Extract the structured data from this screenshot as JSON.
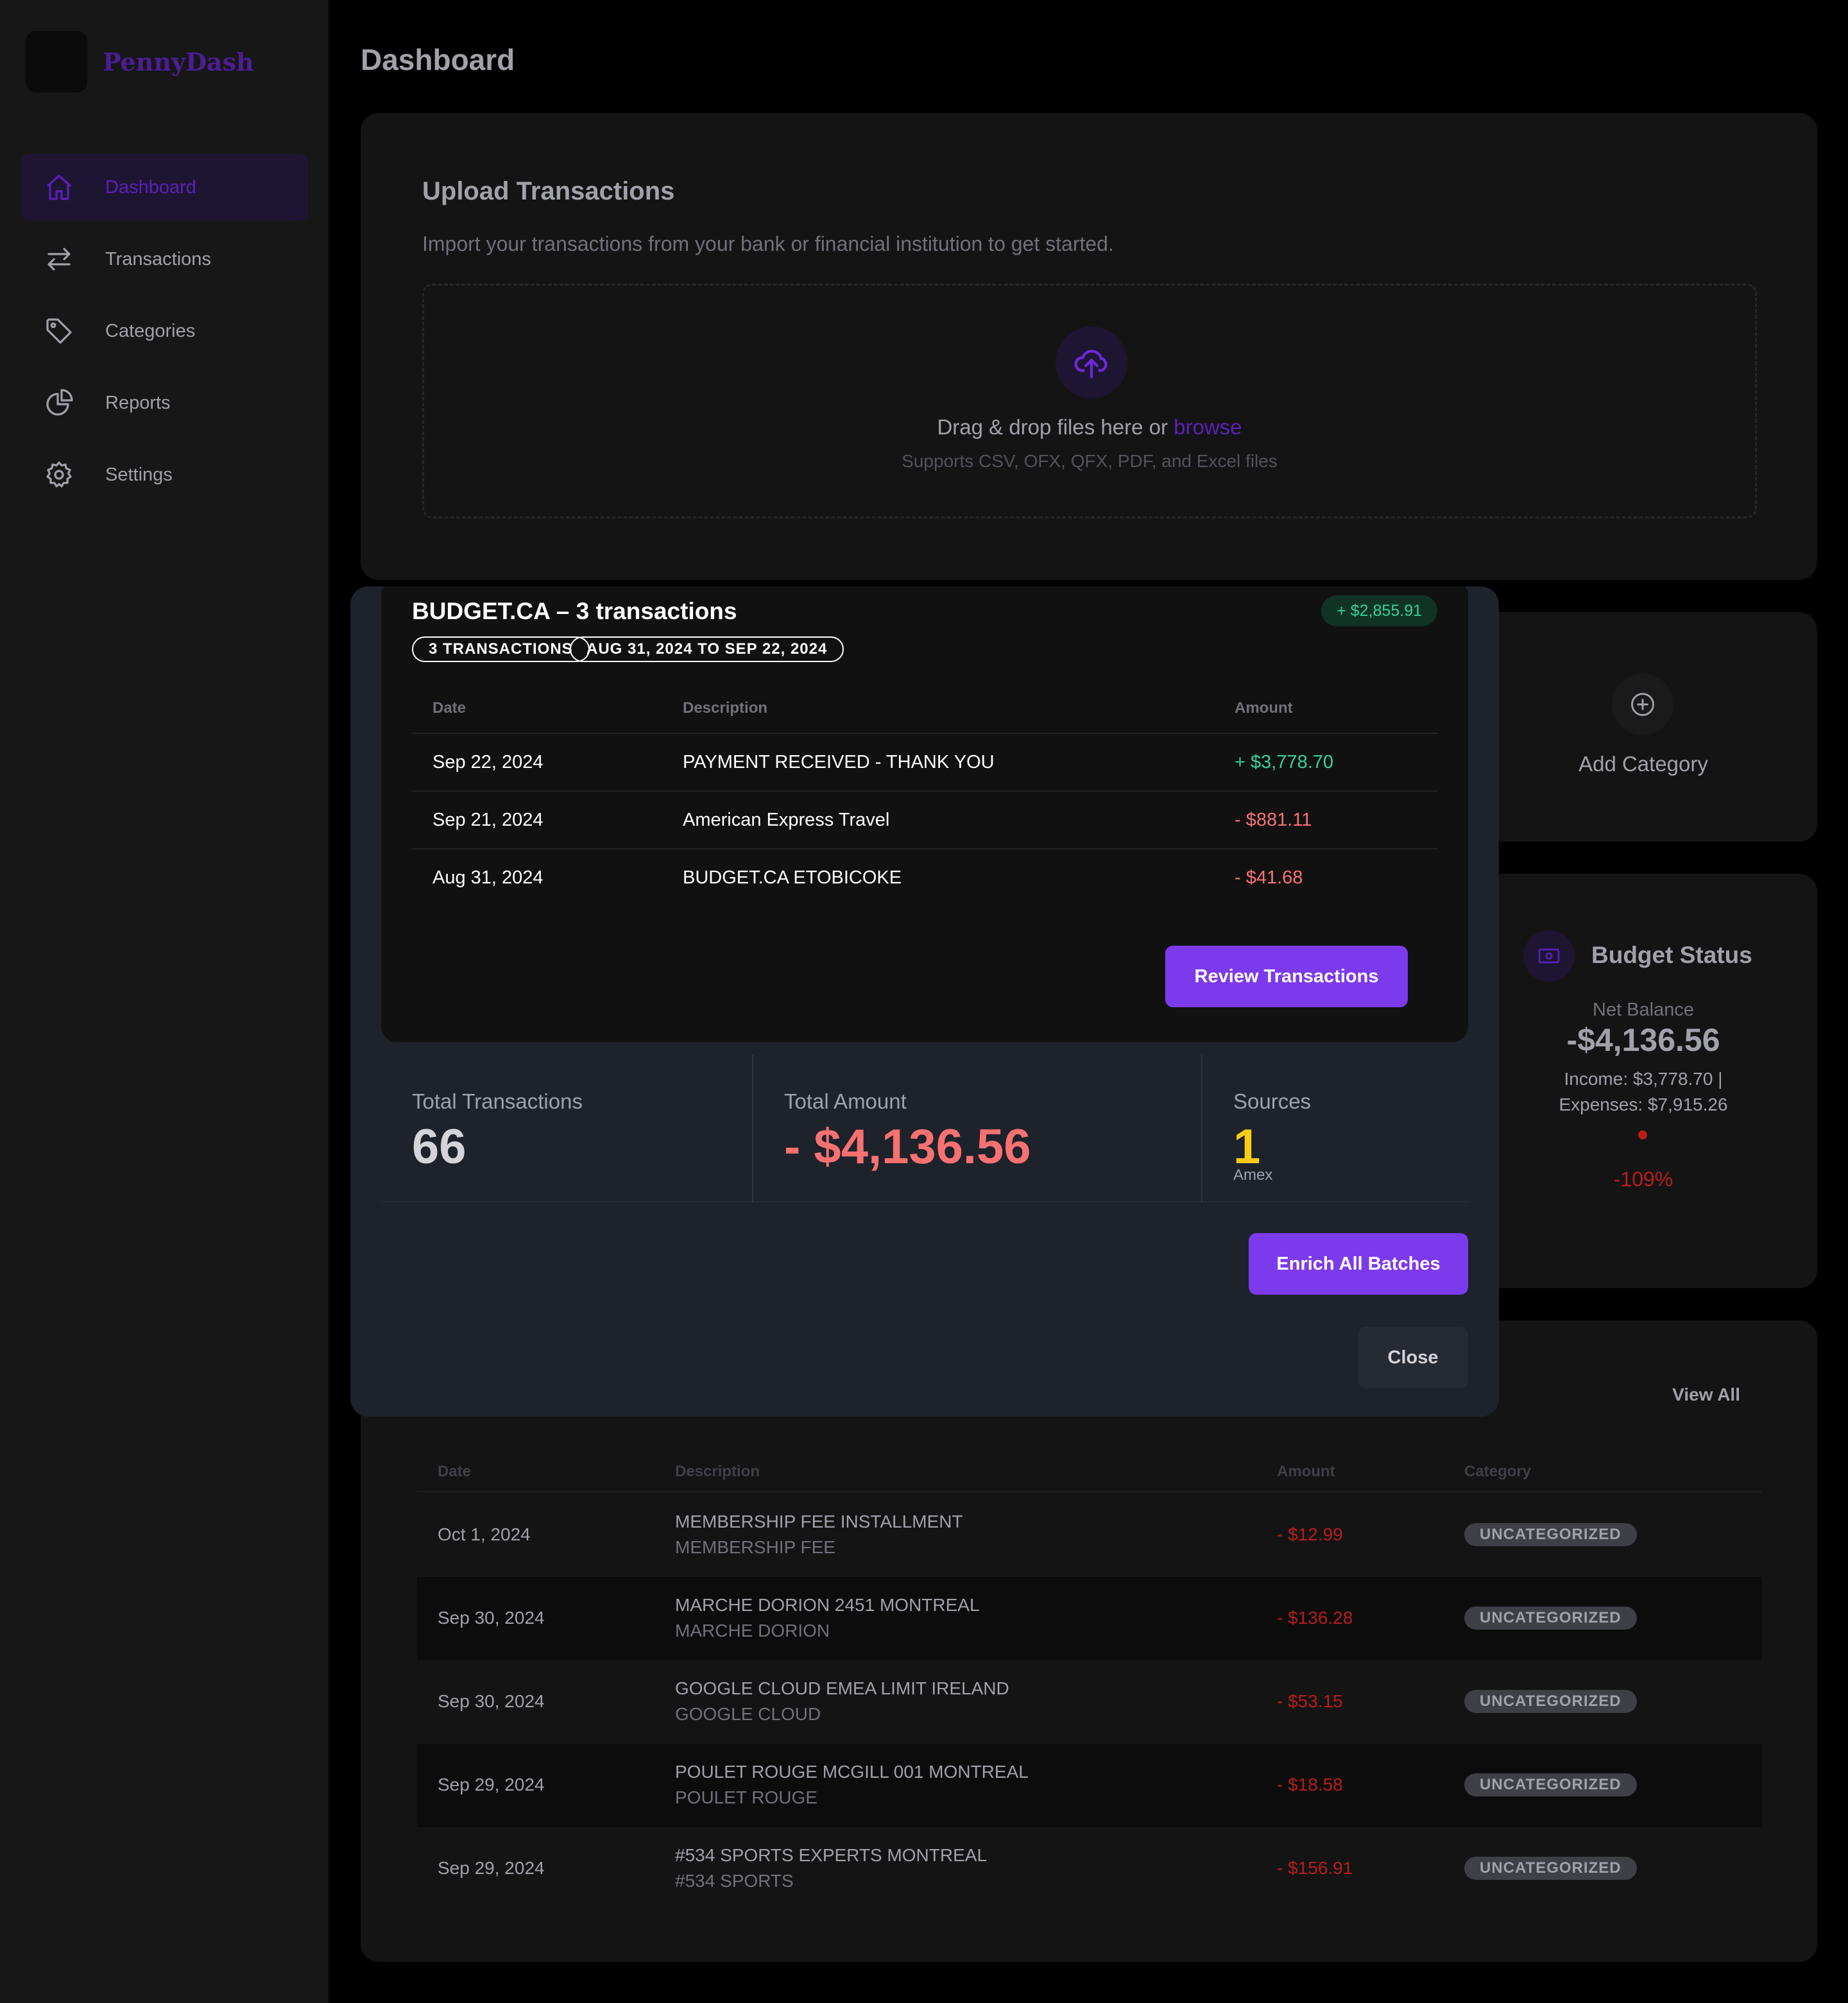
{
  "app": {
    "name": "PennyDash"
  },
  "sidebar": {
    "items": [
      {
        "label": "Dashboard",
        "icon": "home-icon",
        "active": true
      },
      {
        "label": "Transactions",
        "icon": "arrows-swap-icon",
        "active": false
      },
      {
        "label": "Categories",
        "icon": "tag-icon",
        "active": false
      },
      {
        "label": "Reports",
        "icon": "pie-chart-icon",
        "active": false
      },
      {
        "label": "Settings",
        "icon": "gear-icon",
        "active": false
      }
    ]
  },
  "header": {
    "title": "Dashboard"
  },
  "upload": {
    "title": "Upload Transactions",
    "subtitle": "Import your transactions from your bank or financial institution to get started.",
    "drop_text": "Drag & drop files here or",
    "browse_label": "browse",
    "hint": "Supports CSV, OFX, QFX, PDF, and Excel files"
  },
  "add_category": {
    "label": "Add Category"
  },
  "budget": {
    "title": "Budget Status",
    "net_label": "Net Balance",
    "net_value": "-$4,136.56",
    "income_line": "Income: $3,778.70 |",
    "expenses_line": "Expenses: $7,915.26",
    "percent": "-109%"
  },
  "recent": {
    "view_all": "View All",
    "columns": [
      "Date",
      "Description",
      "Amount",
      "Category"
    ],
    "rows": [
      {
        "date": "Oct 1, 2024",
        "desc": "MEMBERSHIP FEE INSTALLMENT",
        "sub": "MEMBERSHIP FEE",
        "amount": "- $12.99",
        "category": "UNCATEGORIZED"
      },
      {
        "date": "Sep 30, 2024",
        "desc": "MARCHE DORION 2451 MONTREAL",
        "sub": "MARCHE DORION",
        "amount": "- $136.28",
        "category": "UNCATEGORIZED"
      },
      {
        "date": "Sep 30, 2024",
        "desc": "GOOGLE CLOUD EMEA LIMIT IRELAND",
        "sub": "GOOGLE CLOUD",
        "amount": "- $53.15",
        "category": "UNCATEGORIZED"
      },
      {
        "date": "Sep 29, 2024",
        "desc": "POULET ROUGE MCGILL 001 MONTREAL",
        "sub": "POULET ROUGE",
        "amount": "- $18.58",
        "category": "UNCATEGORIZED"
      },
      {
        "date": "Sep 29, 2024",
        "desc": "#534 SPORTS EXPERTS MONTREAL",
        "sub": "#534 SPORTS",
        "amount": "- $156.91",
        "category": "UNCATEGORIZED"
      }
    ]
  },
  "modal": {
    "batch": {
      "title": "BUDGET.CA – 3 transactions",
      "badge": "+ $2,855.91",
      "pill_count": "3 TRANSACTIONS",
      "pill_range": "AUG 31, 2024 TO SEP 22, 2024",
      "columns": [
        "Date",
        "Description",
        "Amount"
      ],
      "rows": [
        {
          "date": "Sep 22, 2024",
          "desc": "PAYMENT RECEIVED - THANK YOU",
          "amount": "+ $3,778.70"
        },
        {
          "date": "Sep 21, 2024",
          "desc": "American Express Travel",
          "amount": "- $881.11"
        },
        {
          "date": "Aug 31, 2024",
          "desc": "BUDGET.CA ETOBICOKE",
          "amount": "- $41.68"
        }
      ],
      "review_label": "Review Transactions"
    },
    "stats": {
      "total_tx_label": "Total Transactions",
      "total_tx_value": "66",
      "total_amount_label": "Total Amount",
      "total_amount_value": "- $4,136.56",
      "sources_label": "Sources",
      "sources_value": "1",
      "sources_caption": "Amex"
    },
    "enrich_label": "Enrich All Batches",
    "close_label": "Close"
  },
  "colors": {
    "accent": "#7c3aed",
    "positive": "#34d399",
    "negative": "#f87171",
    "highlight": "#facc15"
  }
}
